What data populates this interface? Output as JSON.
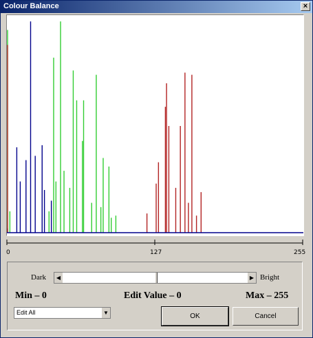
{
  "window": {
    "title": "Colour Balance",
    "close_glyph": "×"
  },
  "axis": {
    "ticks": [
      "0",
      "127",
      "255"
    ]
  },
  "slider": {
    "left_label": "Dark",
    "right_label": "Bright",
    "value": 0,
    "min": -255,
    "max": 255
  },
  "readouts": {
    "min": "Min – 0",
    "edit_value": "Edit Value – 0",
    "max": "Max – 255"
  },
  "channel_select": {
    "selected": "Edit All"
  },
  "buttons": {
    "ok": "OK",
    "cancel": "Cancel"
  },
  "icons": {
    "close": "close-icon",
    "scroll_left": "left-arrow-icon",
    "scroll_right": "right-arrow-icon",
    "dropdown": "chevron-down-icon"
  },
  "chart_data": {
    "type": "bar",
    "title": "",
    "xlabel": "",
    "ylabel": "",
    "xlim": [
      0,
      255
    ],
    "colors": {
      "red": "#b22222",
      "green": "#32cd32",
      "blue": "#00008b"
    },
    "series": [
      {
        "name": "blue",
        "x": [
          0,
          8,
          11,
          16,
          20,
          24,
          30,
          32,
          38
        ],
        "values": [
          0.02,
          0.4,
          0.24,
          0.34,
          0.99,
          0.36,
          0.41,
          0.2,
          0.15
        ]
      },
      {
        "name": "green",
        "x": [
          0,
          2,
          36,
          40,
          42,
          46,
          49,
          54,
          57,
          60,
          65,
          66,
          73,
          77,
          81,
          83,
          88,
          90,
          94
        ],
        "values": [
          0.95,
          0.1,
          0.1,
          0.82,
          0.24,
          0.99,
          0.29,
          0.21,
          0.76,
          0.62,
          0.43,
          0.62,
          0.14,
          0.74,
          0.12,
          0.35,
          0.31,
          0.07,
          0.08
        ]
      },
      {
        "name": "red",
        "x": [
          0,
          121,
          129,
          131,
          137,
          138,
          140,
          146,
          150,
          154,
          157,
          160,
          164,
          168
        ],
        "values": [
          0.88,
          0.09,
          0.23,
          0.33,
          0.59,
          0.7,
          0.5,
          0.21,
          0.5,
          0.75,
          0.14,
          0.74,
          0.08,
          0.19
        ]
      }
    ]
  }
}
